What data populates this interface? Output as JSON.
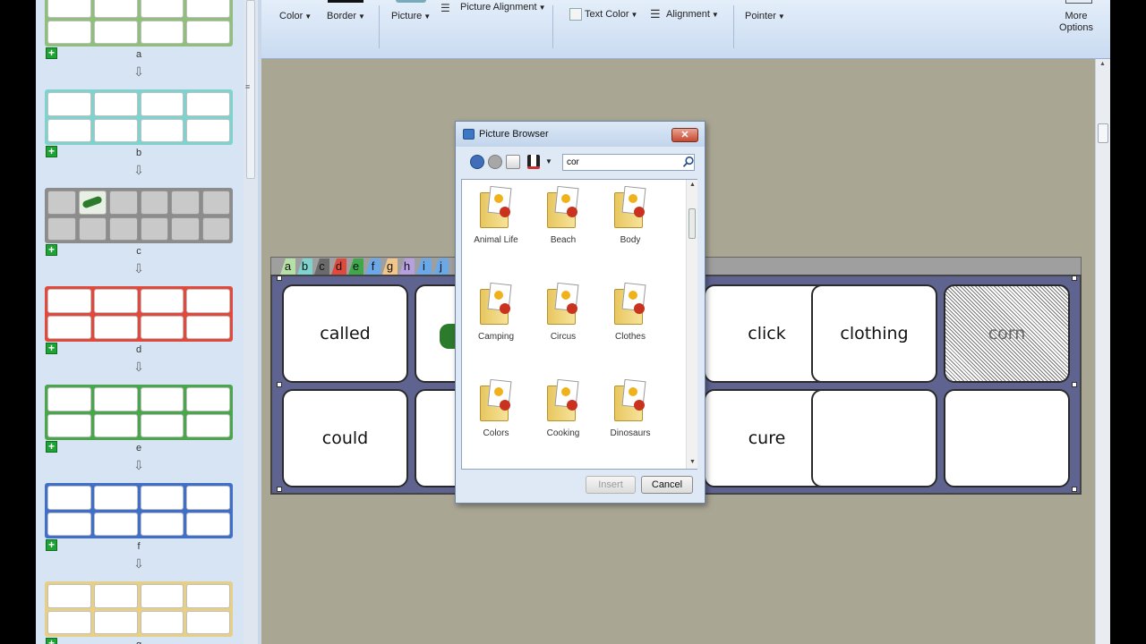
{
  "ribbon": {
    "color": "Color",
    "border": "Border",
    "picture": "Picture",
    "picture_alignment": "Picture Alignment",
    "text_color": "Text Color",
    "alignment": "Alignment",
    "pointer": "Pointer",
    "more_options_line1": "More",
    "more_options_line2": "Options"
  },
  "thumbnails": [
    {
      "label": "a",
      "color": "#8fbf7a"
    },
    {
      "label": "b",
      "color": "#7fd3cf"
    },
    {
      "label": "c",
      "color": "#8c8c8c"
    },
    {
      "label": "d",
      "color": "#e0493b"
    },
    {
      "label": "e",
      "color": "#4aa64a"
    },
    {
      "label": "f",
      "color": "#3f6fc9"
    },
    {
      "label": "g",
      "color": "#e8cf86"
    }
  ],
  "board": {
    "tabs": [
      {
        "letter": "a",
        "color": "#b5e0a6"
      },
      {
        "letter": "b",
        "color": "#7fd3cf"
      },
      {
        "letter": "c",
        "color": "#6a6a6a"
      },
      {
        "letter": "d",
        "color": "#e0493b"
      },
      {
        "letter": "e",
        "color": "#3fa84a"
      },
      {
        "letter": "f",
        "color": "#6aa8e8"
      },
      {
        "letter": "g",
        "color": "#f2c58a"
      },
      {
        "letter": "h",
        "color": "#b6a0e0"
      },
      {
        "letter": "i",
        "color": "#6aa8e8"
      },
      {
        "letter": "j",
        "color": "#6aa8e8"
      }
    ],
    "row1": [
      "called",
      "",
      "click",
      "clothing",
      "corn"
    ],
    "row2": [
      "could",
      "",
      "cure",
      "",
      ""
    ]
  },
  "dialog": {
    "title": "Picture Browser",
    "close": "✕",
    "search_value": "cor",
    "folders": [
      "Animal Life",
      "Beach",
      "Body",
      "Camping",
      "Circus",
      "Clothes",
      "Colors",
      "Cooking",
      "Dinosaurs"
    ],
    "insert": "Insert",
    "cancel": "Cancel"
  }
}
